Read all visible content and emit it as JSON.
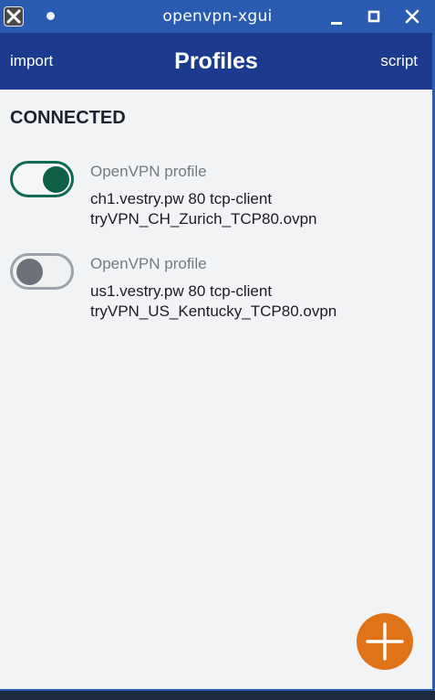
{
  "window": {
    "title": "openvpn-xgui"
  },
  "header": {
    "import_label": "import",
    "title": "Profiles",
    "script_label": "script"
  },
  "content": {
    "section_title": "CONNECTED",
    "profiles": [
      {
        "type": "OpenVPN profile",
        "server": "ch1.vestry.pw 80 tcp-client",
        "file": "tryVPN_CH_Zurich_TCP80.ovpn",
        "enabled": true
      },
      {
        "type": "OpenVPN profile",
        "server": "us1.vestry.pw 80 tcp-client",
        "file": "tryVPN_US_Kentucky_TCP80.ovpn",
        "enabled": false
      }
    ]
  },
  "icons": {
    "app": "x-close-icon",
    "minimize": "minimize-icon",
    "maximize": "maximize-icon",
    "close": "close-icon",
    "add": "plus-icon"
  },
  "colors": {
    "titlebar": "#2a5bb0",
    "header": "#1c3b8e",
    "toggle_on": "#0e6b52",
    "toggle_off": "#9ea3ab",
    "fab": "#e07318",
    "background": "#f2f3f5"
  }
}
